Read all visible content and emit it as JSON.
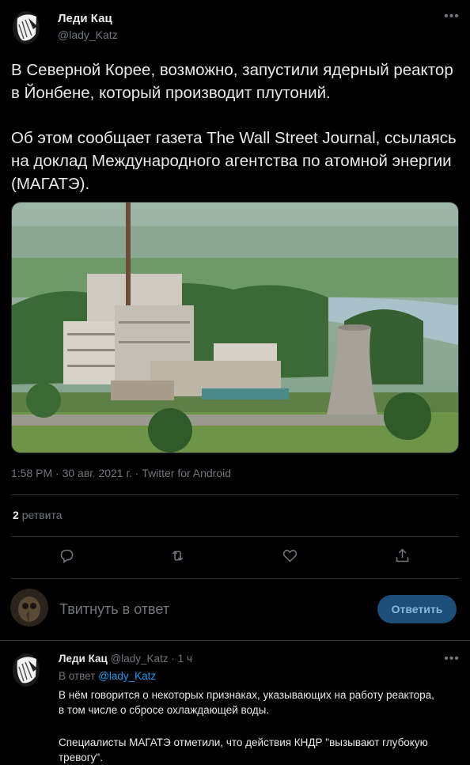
{
  "main_tweet": {
    "author_name": "Леди Кац",
    "author_handle": "@lady_Katz",
    "paragraph1": "В Северной Корее, возможно, запустили ядерный реактор в Йонбене, который производит плутоний.",
    "paragraph2": "Об этом сообщает газета The Wall Street Journal, ссылаясь на доклад Международного агентства по атомной энергии (МАГАТЭ).",
    "timestamp": "1:58 PM · 30 авг. 2021 г. · Twitter for Android",
    "retweet_count": "2",
    "retweet_label": "ретвита"
  },
  "actions": {
    "icons": [
      "reply-icon",
      "retweet-icon",
      "like-icon",
      "share-icon"
    ]
  },
  "composer": {
    "placeholder": "Твитнуть в ответ",
    "button_label": "Ответить"
  },
  "reply": {
    "author_name": "Леди Кац",
    "author_handle": "@lady_Katz",
    "time": "· 1 ч",
    "in_reply_prefix": "В ответ",
    "in_reply_handle": "@lady_Katz",
    "paragraph1": "В нём говорится о некоторых признаках, указывающих на работу реактора, в том числе о сбросе охлаждающей воды.",
    "paragraph2": "Специалисты МАГАТЭ отметили, что действия КНДР \"вызывают глубокую тревогу\"."
  },
  "colors": {
    "background": "#000000",
    "text": "#e7e9ea",
    "muted": "#71767b",
    "link": "#1d9bf0",
    "reply_button": "#1d4e78"
  }
}
